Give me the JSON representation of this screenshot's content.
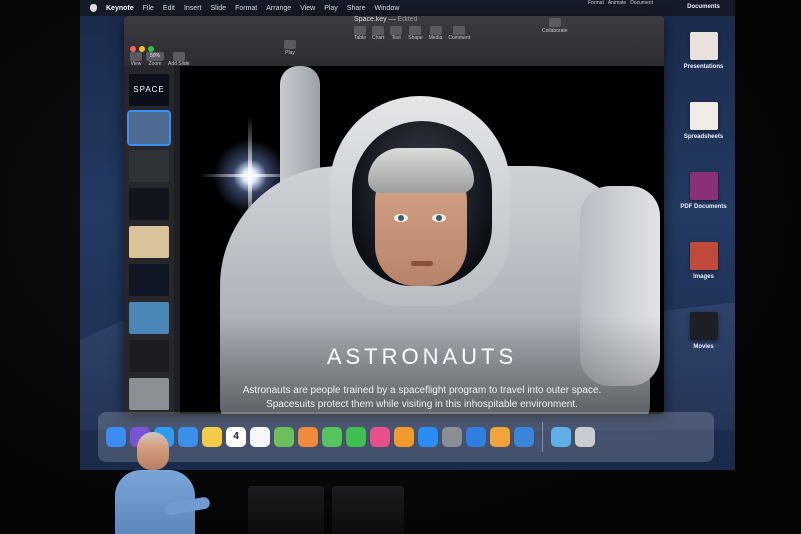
{
  "menubar": {
    "app_name": "Keynote",
    "items": [
      "File",
      "Edit",
      "Insert",
      "Slide",
      "Format",
      "Arrange",
      "View",
      "Play",
      "Share",
      "Window"
    ]
  },
  "window": {
    "doc_title": "Space.key",
    "doc_status": "Edited",
    "toolbar_left": [
      {
        "label": "View",
        "icon": "view-icon"
      },
      {
        "label": "Zoom",
        "value": "50%",
        "icon": "zoom-icon"
      },
      {
        "label": "Add Slide",
        "icon": "add-slide-icon"
      }
    ],
    "toolbar_play": {
      "label": "Play",
      "icon": "play-icon"
    },
    "toolbar_center": [
      {
        "label": "Table",
        "icon": "table-icon"
      },
      {
        "label": "Chart",
        "icon": "chart-icon"
      },
      {
        "label": "Text",
        "icon": "text-icon"
      },
      {
        "label": "Shape",
        "icon": "shape-icon"
      },
      {
        "label": "Media",
        "icon": "media-icon"
      },
      {
        "label": "Comment",
        "icon": "comment-icon"
      }
    ],
    "toolbar_collaborate": {
      "label": "Collaborate",
      "icon": "collaborate-icon"
    },
    "toolbar_right": [
      {
        "label": "Format"
      },
      {
        "label": "Animate"
      },
      {
        "label": "Document"
      }
    ]
  },
  "navigator": {
    "slides": [
      {
        "title": "SPACE",
        "color": "#0b0f1c",
        "selected": false
      },
      {
        "title": "",
        "color": "#4d6a93",
        "selected": true
      },
      {
        "title": "",
        "color": "#2f3338",
        "selected": false
      },
      {
        "title": "",
        "color": "#12151d",
        "selected": false
      },
      {
        "title": "",
        "color": "#d9c39a",
        "selected": false
      },
      {
        "title": "",
        "color": "#101725",
        "selected": false
      },
      {
        "title": "",
        "color": "#4a86b8",
        "selected": false
      },
      {
        "title": "",
        "color": "#1b1d22",
        "selected": false
      },
      {
        "title": "",
        "color": "#8c8f93",
        "selected": false
      }
    ]
  },
  "slide": {
    "title": "ASTRONAUTS",
    "body": "Astronauts are people trained by a spaceflight program to travel into outer space. Spacesuits protect them while visiting in this inhospitable environment."
  },
  "sidebar": {
    "header": "Documents",
    "stacks": [
      {
        "label": "Presentations",
        "color": "#e7e3dc",
        "icon": "presentations-stack-icon"
      },
      {
        "label": "Spreadsheets",
        "color": "#f1ede6",
        "icon": "spreadsheets-stack-icon"
      },
      {
        "label": "PDF Documents",
        "color": "#8a2f7a",
        "icon": "pdf-stack-icon"
      },
      {
        "label": "Images",
        "color": "#c14a3a",
        "icon": "images-stack-icon"
      },
      {
        "label": "Movies",
        "color": "#1c1f24",
        "icon": "movies-stack-icon"
      }
    ]
  },
  "dock": {
    "apps": [
      {
        "name": "finder-icon",
        "color": "#3d8cf2"
      },
      {
        "name": "siri-icon",
        "color": "#7a52d6"
      },
      {
        "name": "safari-icon",
        "color": "#2d9cf4"
      },
      {
        "name": "mail-icon",
        "color": "#3c8fe8"
      },
      {
        "name": "notes-icon",
        "color": "#f2cc49"
      },
      {
        "name": "calendar-icon",
        "color": "#ffffff",
        "badge": "4"
      },
      {
        "name": "reminders-icon",
        "color": "#f7f7f7"
      },
      {
        "name": "maps-icon",
        "color": "#6dbf5c"
      },
      {
        "name": "photos-icon",
        "color": "#f08a3c"
      },
      {
        "name": "messages-icon",
        "color": "#55c45c"
      },
      {
        "name": "facetime-icon",
        "color": "#3fbf4f"
      },
      {
        "name": "itunes-icon",
        "color": "#ea4f8d"
      },
      {
        "name": "books-icon",
        "color": "#f29a2e"
      },
      {
        "name": "app-store-icon",
        "color": "#2a8df5"
      },
      {
        "name": "system-preferences-icon",
        "color": "#8a8f96"
      },
      {
        "name": "keynote-icon",
        "color": "#2f7fe0"
      },
      {
        "name": "pages-icon",
        "color": "#f1a33c"
      },
      {
        "name": "xcode-icon",
        "color": "#3a86d9"
      },
      {
        "name": "downloads-folder-icon",
        "color": "#5fb0e8"
      },
      {
        "name": "trash-icon",
        "color": "#c9cdd2"
      }
    ]
  }
}
